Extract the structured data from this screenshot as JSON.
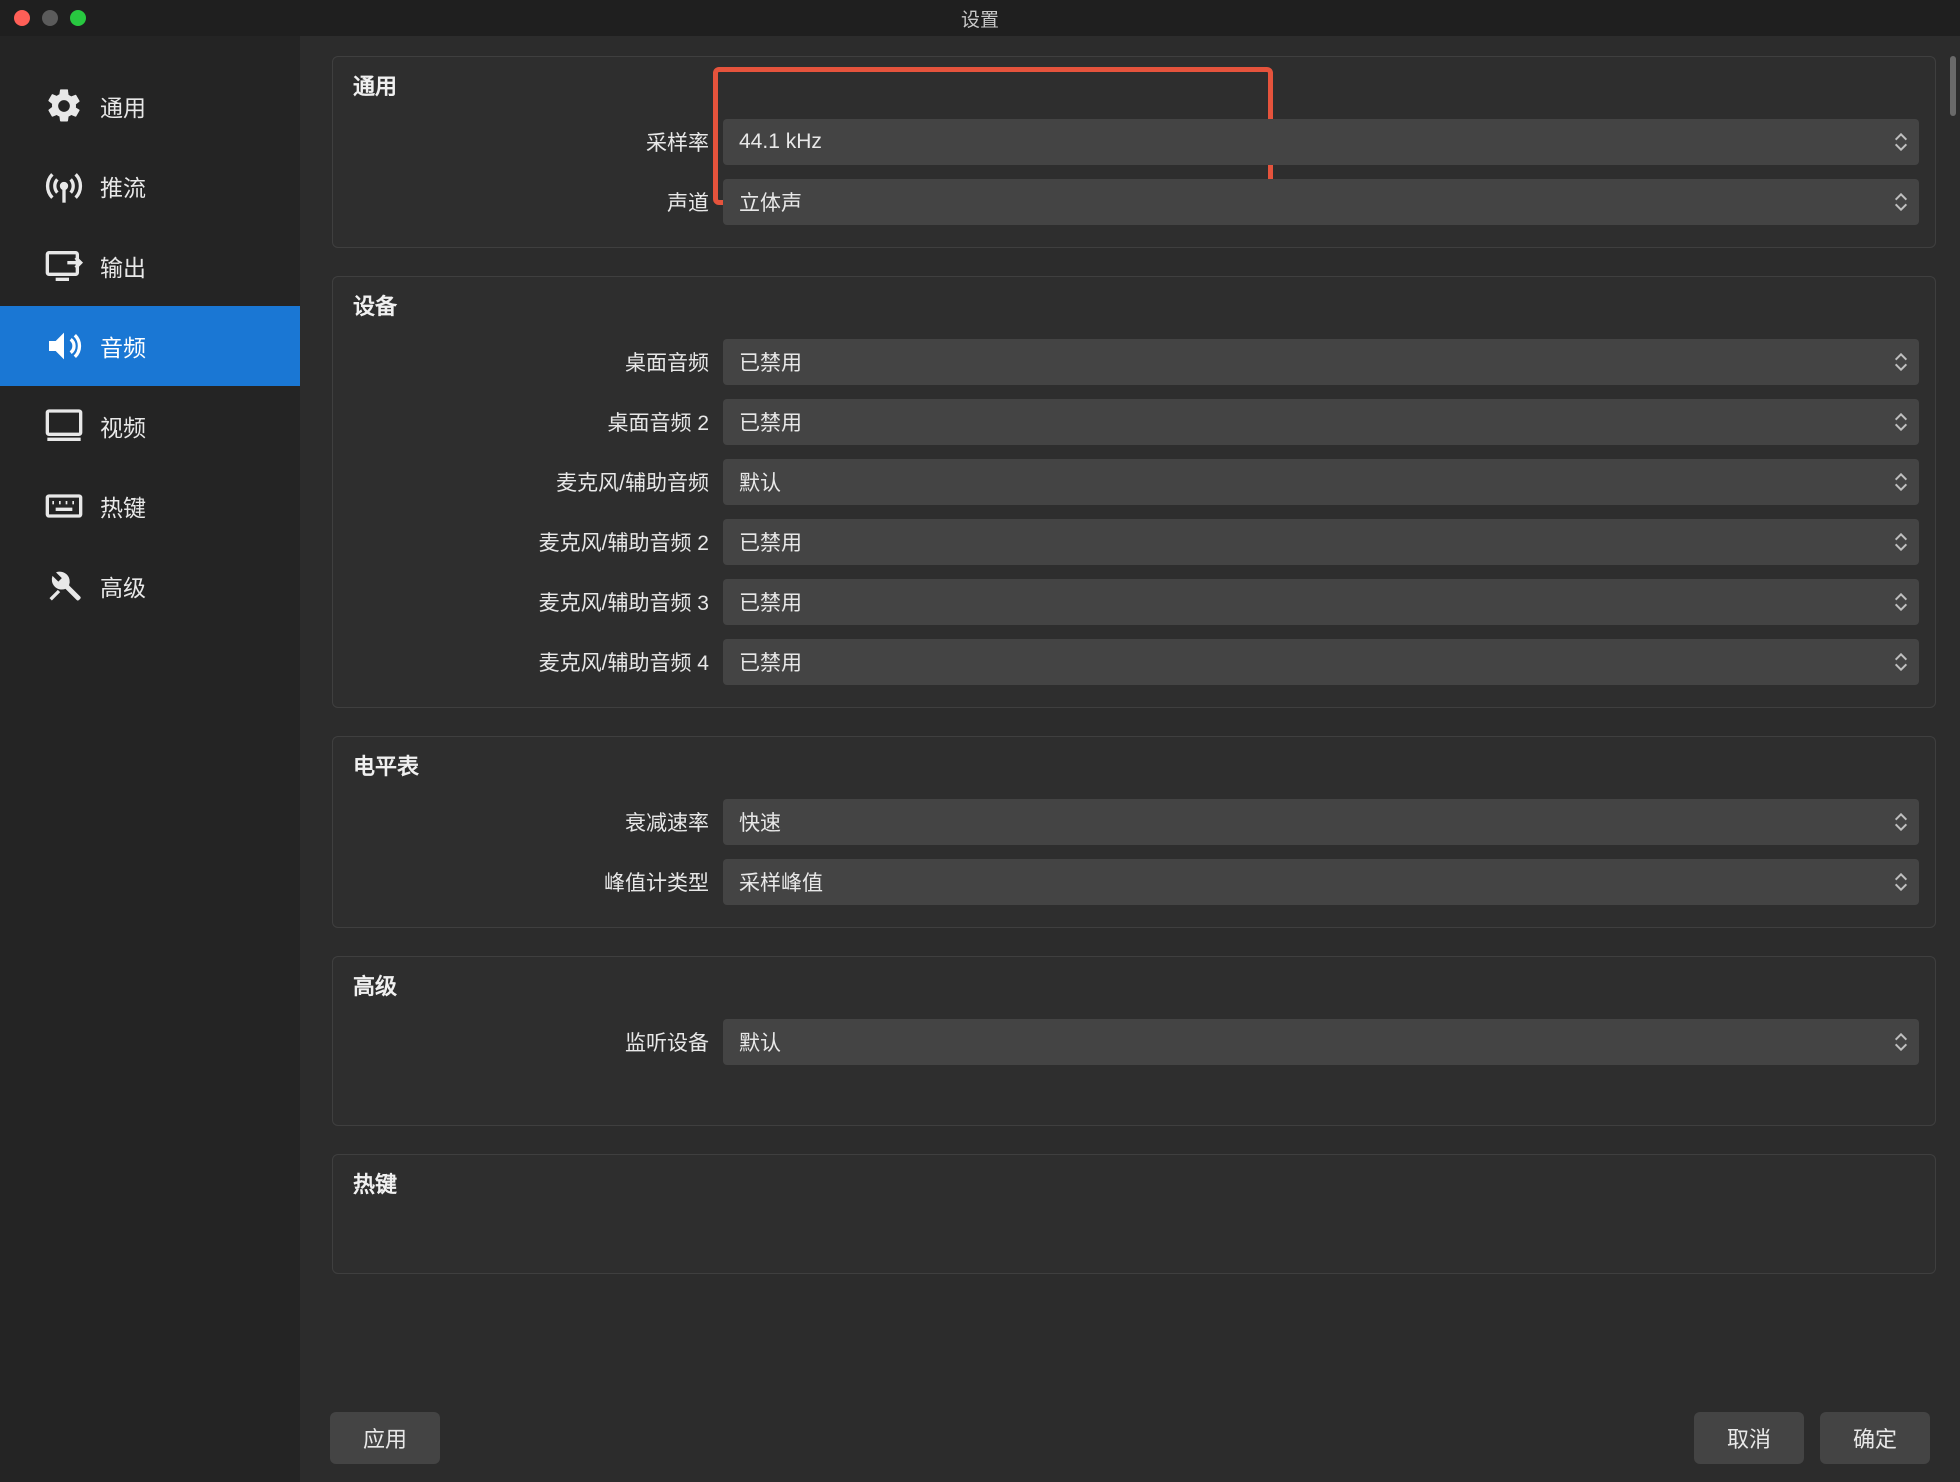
{
  "window": {
    "title": "设置"
  },
  "sidebar": {
    "items": [
      {
        "label": "通用"
      },
      {
        "label": "推流"
      },
      {
        "label": "输出"
      },
      {
        "label": "音频"
      },
      {
        "label": "视频"
      },
      {
        "label": "热键"
      },
      {
        "label": "高级"
      }
    ]
  },
  "panels": {
    "general": {
      "title": "通用",
      "sample_rate_label": "采样率",
      "sample_rate_value": "44.1 kHz",
      "channels_label": "声道",
      "channels_value": "立体声"
    },
    "devices": {
      "title": "设备",
      "desktop_audio_label": "桌面音频",
      "desktop_audio_value": "已禁用",
      "desktop_audio2_label": "桌面音频 2",
      "desktop_audio2_value": "已禁用",
      "mic1_label": "麦克风/辅助音频",
      "mic1_value": "默认",
      "mic2_label": "麦克风/辅助音频 2",
      "mic2_value": "已禁用",
      "mic3_label": "麦克风/辅助音频 3",
      "mic3_value": "已禁用",
      "mic4_label": "麦克风/辅助音频 4",
      "mic4_value": "已禁用"
    },
    "meters": {
      "title": "电平表",
      "decay_label": "衰减速率",
      "decay_value": "快速",
      "peak_label": "峰值计类型",
      "peak_value": "采样峰值"
    },
    "advanced": {
      "title": "高级",
      "monitor_label": "监听设备",
      "monitor_value": "默认"
    },
    "hotkeys": {
      "title": "热键"
    }
  },
  "footer": {
    "apply": "应用",
    "cancel": "取消",
    "ok": "确定"
  }
}
